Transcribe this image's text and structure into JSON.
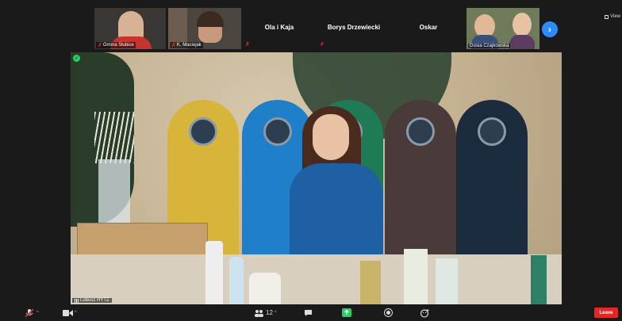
{
  "gallery": {
    "tiles": [
      {
        "name": "Gmina Słubice",
        "type": "video",
        "muted": true
      },
      {
        "name": "K. Maciejak",
        "type": "video",
        "muted": true
      },
      {
        "name": "Ola i Kaja",
        "type": "name-only",
        "muted": true
      },
      {
        "name": "Borys Drzewiecki",
        "type": "name-only",
        "muted": true
      },
      {
        "name": "Oskar",
        "type": "name-only",
        "muted": false
      },
      {
        "name": "Gosia Czajkowska",
        "type": "video",
        "muted": false
      }
    ],
    "next_icon": "chevron-right-icon",
    "view_label": "View"
  },
  "main_video": {
    "speaker_name": "Lubusz HYTZ",
    "active_indicator_icon": "shield-icon"
  },
  "toolbar": {
    "mute_icon": "microphone-muted-icon",
    "video_icon": "video-camera-icon",
    "participants_icon": "participants-icon",
    "participants_count": "12",
    "chat_icon": "chat-icon",
    "share_icon": "share-screen-icon",
    "record_icon": "record-icon",
    "reactions_icon": "reactions-icon",
    "leave_label": "Leave",
    "colors": {
      "share": "#23d160",
      "leave": "#e02828",
      "muted": "#e8382c",
      "next_button": "#2d8cff"
    }
  }
}
